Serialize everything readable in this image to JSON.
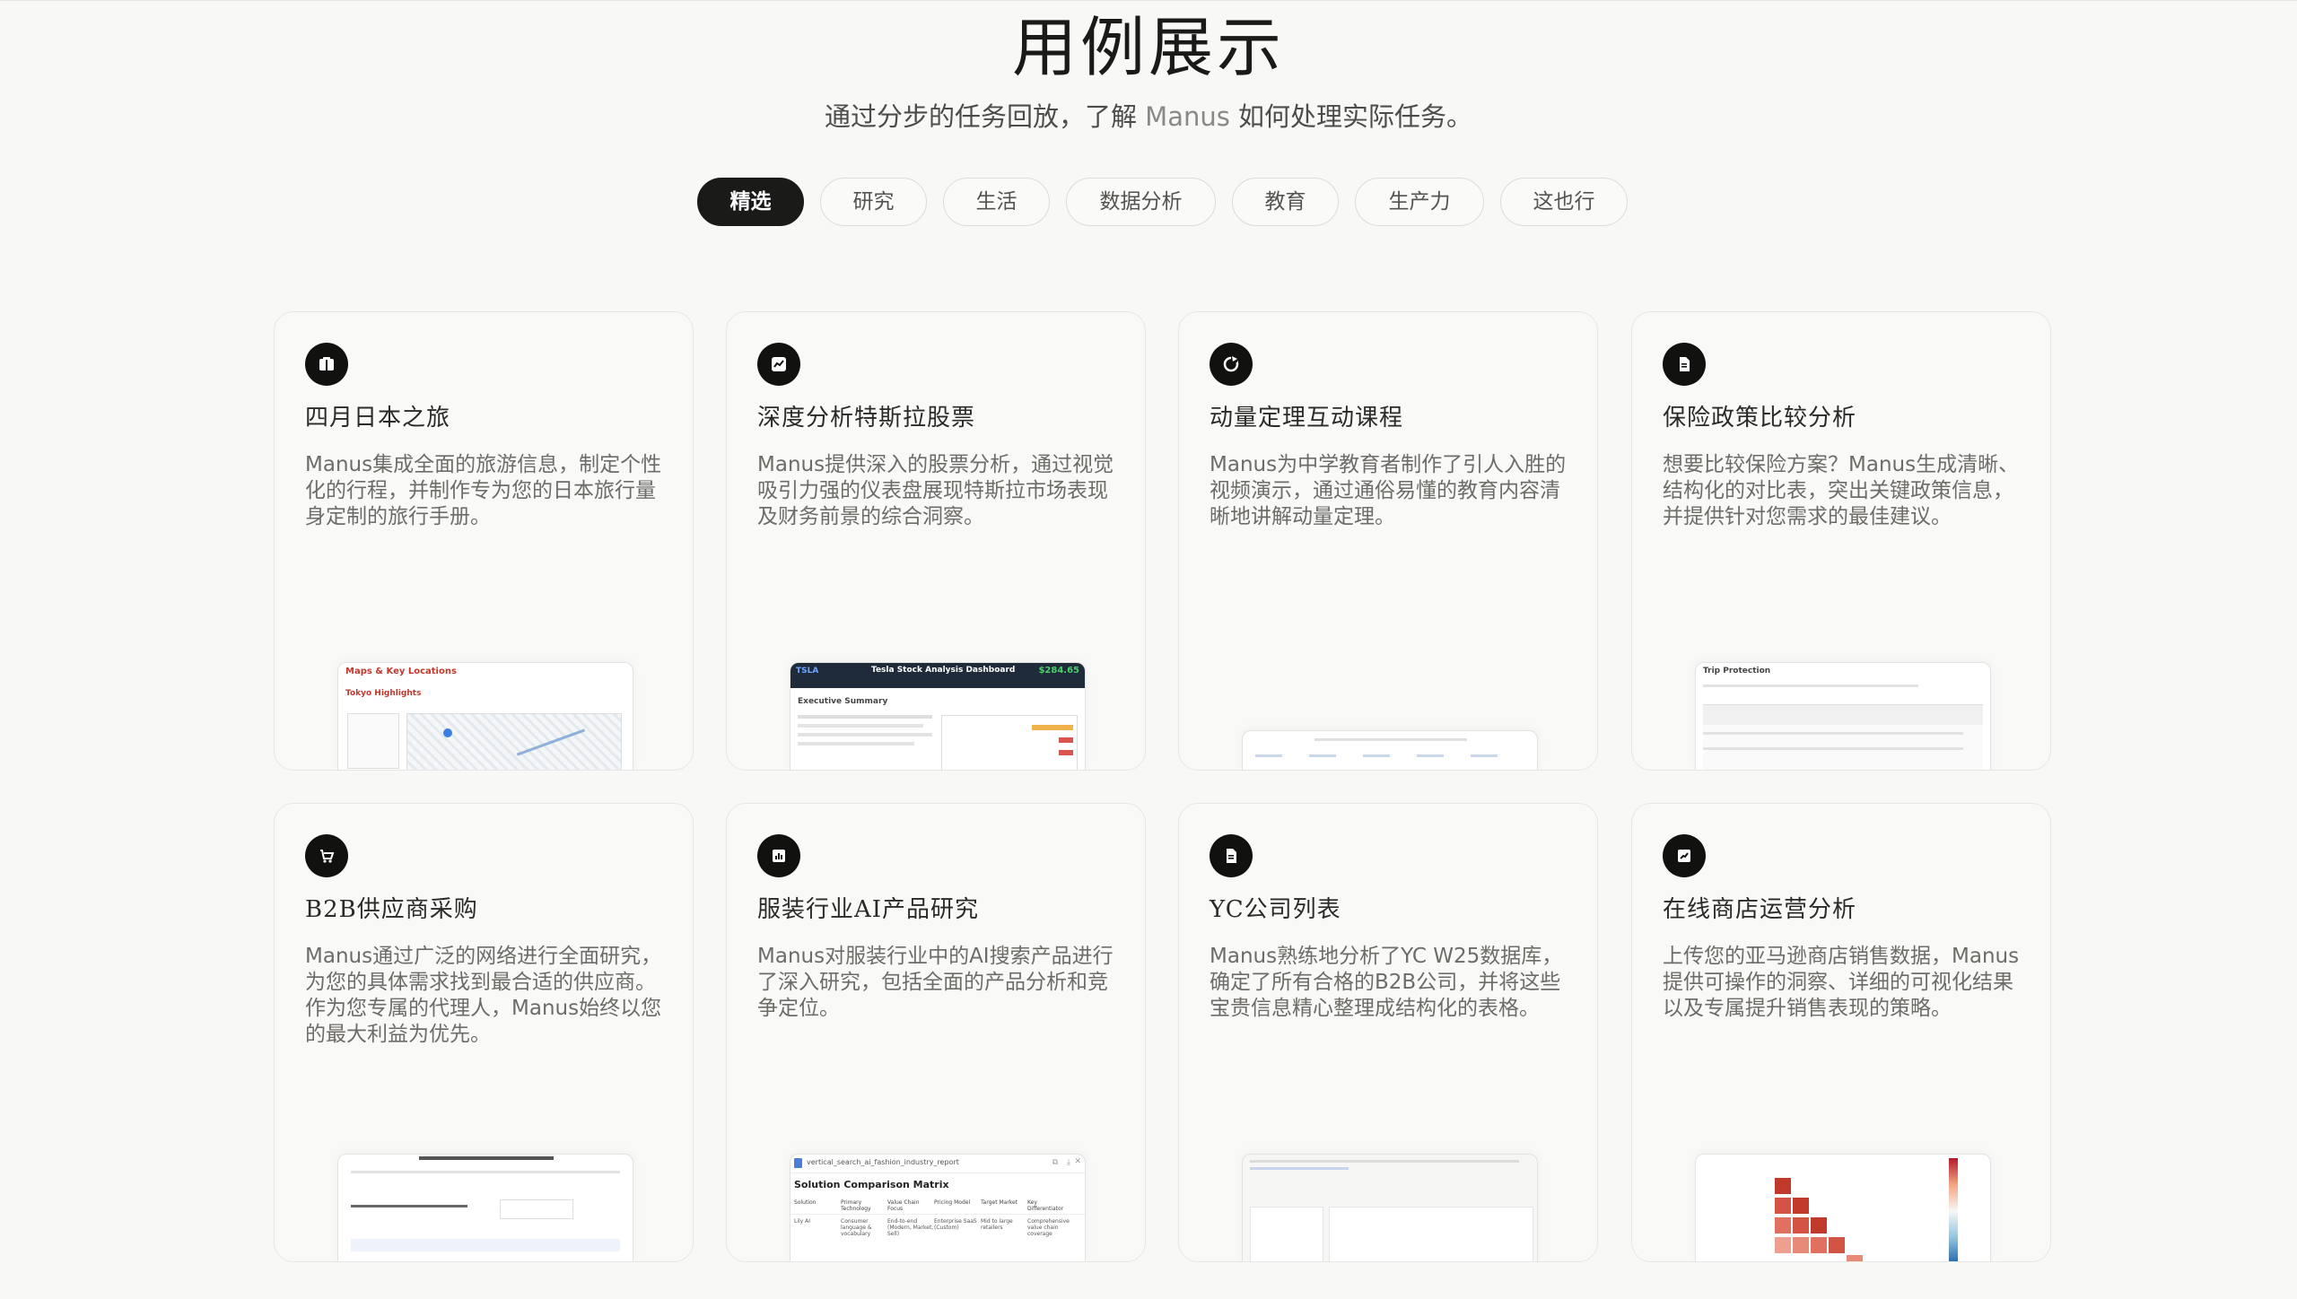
{
  "header": {
    "title": "用例展示",
    "subtitle_pre": "通过分步的任务回放，了解 ",
    "subtitle_brand": "Manus",
    "subtitle_post": " 如何处理实际任务。"
  },
  "tabs": [
    {
      "label": "精选",
      "active": true
    },
    {
      "label": "研究"
    },
    {
      "label": "生活"
    },
    {
      "label": "数据分析"
    },
    {
      "label": "教育"
    },
    {
      "label": "生产力"
    },
    {
      "label": "这也行"
    }
  ],
  "cards": [
    {
      "icon": "book-icon",
      "title": "四月日本之旅",
      "desc": "Manus集成全面的旅游信息，制定个性化的行程，并制作专为您的日本旅行量身定制的旅行手册。",
      "thumb": {
        "heading": "Maps & Key Locations",
        "sub": "Tokyo Highlights"
      }
    },
    {
      "icon": "chart-icon",
      "title": "深度分析特斯拉股票",
      "desc": "Manus提供深入的股票分析，通过视觉吸引力强的仪表盘展现特斯拉市场表现及财务前景的综合洞察。",
      "thumb": {
        "ticker": "TSLA",
        "heading": "Tesla Stock Analysis Dashboard",
        "price": "$284.65",
        "sub": "Executive Summary"
      }
    },
    {
      "icon": "refresh-icon",
      "title": "动量定理互动课程",
      "desc": "Manus为中学教育者制作了引人入胜的视频演示，通过通俗易懂的教育内容清晰地讲解动量定理。",
      "thumb": {}
    },
    {
      "icon": "document-icon",
      "title": "保险政策比较分析",
      "desc": "想要比较保险方案？Manus生成清晰、结构化的对比表，突出关键政策信息，并提供针对您需求的最佳建议。",
      "thumb": {
        "heading": "Trip Protection"
      }
    },
    {
      "icon": "cart-icon",
      "title": "B2B供应商采购",
      "desc": "Manus通过广泛的网络进行全面研究，为您的具体需求找到最合适的供应商。作为您专属的代理人，Manus始终以您的最大利益为优先。",
      "thumb": {}
    },
    {
      "icon": "grid-icon",
      "title": "服装行业AI产品研究",
      "desc": "Manus对服装行业中的AI搜索产品进行了深入研究，包括全面的产品分析和竞争定位。",
      "thumb": {
        "file": "vertical_search_ai_fashion_industry_report",
        "heading": "Solution Comparison Matrix",
        "cols": [
          "Solution",
          "Primary Technology",
          "Value Chain Focus",
          "Pricing Model",
          "Target Market",
          "Key Differentiator"
        ],
        "row": [
          "Lily AI",
          "Consumer language & vocabulary",
          "End-to-end (Modern, Market, Sell)",
          "Enterprise SaaS (Custom)",
          "Mid to large retailers",
          "Comprehensive value chain coverage"
        ]
      }
    },
    {
      "icon": "document-icon",
      "title": "YC公司列表",
      "desc": "Manus熟练地分析了YC W25数据库，确定了所有合格的B2B公司，并将这些宝贵信息精心整理成结构化的表格。",
      "thumb": {}
    },
    {
      "icon": "analytics-icon",
      "title": "在线商店运营分析",
      "desc": "上传您的亚马逊商店销售数据，Manus提供可操作的洞察、详细的可视化结果以及专属提升销售表现的策略。",
      "thumb": {}
    }
  ]
}
